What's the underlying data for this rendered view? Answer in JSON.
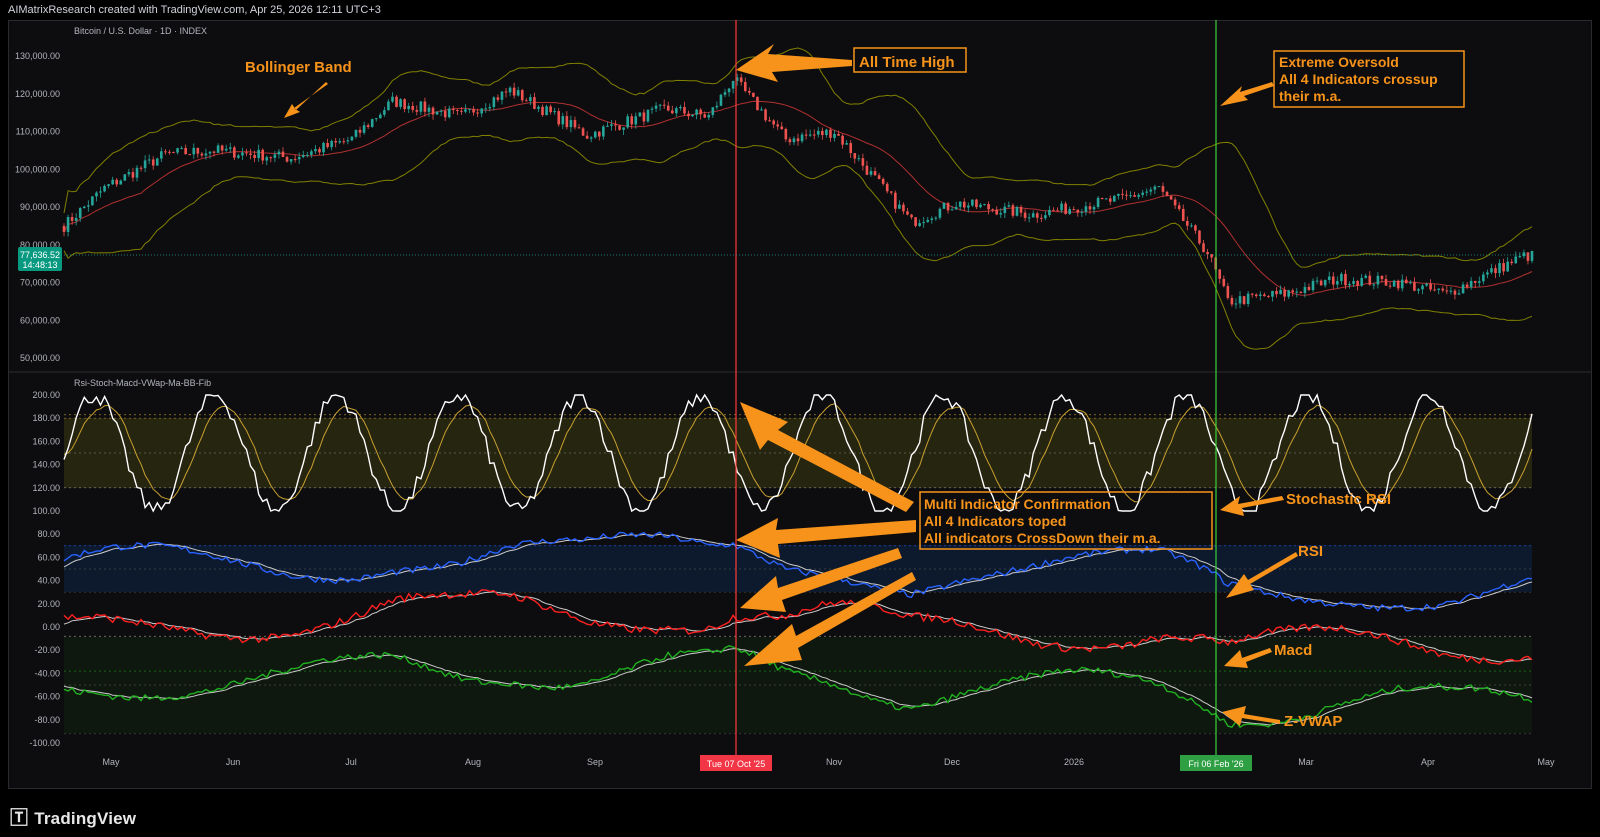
{
  "header": {
    "attribution": "AIMatrixResearch created with TradingView.com, Apr 25, 2026 12:11 UTC+3",
    "symbol_title": "Bitcoin / U.S. Dollar · 1D · INDEX",
    "indicator_title": "Rsi-Stoch-Macd-VWap-Ma-BB-Fib"
  },
  "footer": {
    "brand": "TradingView"
  },
  "price_badge": {
    "price": "77,636.52",
    "countdown": "14:48:13"
  },
  "markers": {
    "top_date": "Tue 07 Oct '25",
    "bottom_date": "Fri 06 Feb '26"
  },
  "annotations": {
    "bollinger": "Bollinger Band",
    "ath": "All Time High",
    "oversold": [
      "Extreme Oversold",
      "All 4 Indicators crossup",
      "their m.a."
    ],
    "confirmation": [
      "Multi Indicator Confirmation",
      "All 4 Indicators toped",
      "All indicators  CrossDown their m.a."
    ],
    "stoch": "Stochastic RSI",
    "rsi": "RSI",
    "macd": "Macd",
    "zvwap": "Z-VWAP"
  },
  "colors": {
    "candle_up": "#26a69a",
    "candle_down": "#ef5350",
    "bb_band": "#808000",
    "bb_mid": "#b03030",
    "stoch": "#ffffff",
    "stoch_signal": "#c8a030",
    "rsi": "#2962ff",
    "macd": "#ff2020",
    "zvwap": "#20b020",
    "annotation": "#f7931a",
    "top_line": "#ff3b3b",
    "bottom_line": "#3bd03b"
  },
  "chart_data": [
    {
      "type": "candlestick",
      "title": "Bitcoin / U.S. Dollar · 1D · INDEX",
      "ylim": [
        50000,
        130000
      ],
      "y_ticks": [
        "130,000.00",
        "120,000.00",
        "110,000.00",
        "100,000.00",
        "90,000.00",
        "80,000.00",
        "70,000.00",
        "60,000.00",
        "50,000.00"
      ],
      "x_ticks": [
        "May",
        "Jun",
        "Jul",
        "Aug",
        "Sep",
        "Nov",
        "Dec",
        "2026",
        "Mar",
        "Apr",
        "May"
      ],
      "last_price": 77636.52,
      "approx_close_path": [
        {
          "x": "2025-04-25",
          "y": 85000
        },
        {
          "x": "2025-05-05",
          "y": 95000
        },
        {
          "x": "2025-05-20",
          "y": 104000
        },
        {
          "x": "2025-06-01",
          "y": 105000
        },
        {
          "x": "2025-06-20",
          "y": 103000
        },
        {
          "x": "2025-07-05",
          "y": 108000
        },
        {
          "x": "2025-07-15",
          "y": 118000
        },
        {
          "x": "2025-08-01",
          "y": 114000
        },
        {
          "x": "2025-08-13",
          "y": 121000
        },
        {
          "x": "2025-09-01",
          "y": 109000
        },
        {
          "x": "2025-09-20",
          "y": 116000
        },
        {
          "x": "2025-10-01",
          "y": 114000
        },
        {
          "x": "2025-10-07",
          "y": 124000
        },
        {
          "x": "2025-10-20",
          "y": 108000
        },
        {
          "x": "2025-11-01",
          "y": 110000
        },
        {
          "x": "2025-11-20",
          "y": 86000
        },
        {
          "x": "2025-12-01",
          "y": 91000
        },
        {
          "x": "2025-12-20",
          "y": 88000
        },
        {
          "x": "2026-01-10",
          "y": 92000
        },
        {
          "x": "2026-01-20",
          "y": 95000
        },
        {
          "x": "2026-02-01",
          "y": 78000
        },
        {
          "x": "2026-02-06",
          "y": 65000
        },
        {
          "x": "2026-02-20",
          "y": 67000
        },
        {
          "x": "2026-03-05",
          "y": 71000
        },
        {
          "x": "2026-03-20",
          "y": 70000
        },
        {
          "x": "2026-04-01",
          "y": 67000
        },
        {
          "x": "2026-04-20",
          "y": 77000
        }
      ]
    },
    {
      "type": "line",
      "title": "Rsi-Stoch-Macd-VWap-Ma-BB-Fib",
      "ylim": [
        -100,
        200
      ],
      "y_ticks": [
        "200.00",
        "180.00",
        "160.00",
        "140.00",
        "120.00",
        "100.00",
        "80.00",
        "60.00",
        "40.00",
        "20.00",
        "0.00",
        "-20.00",
        "-40.00",
        "-60.00",
        "-80.00",
        "-100.00"
      ],
      "series": [
        {
          "name": "Stochastic RSI"
        },
        {
          "name": "RSI"
        },
        {
          "name": "Macd"
        },
        {
          "name": "Z-VWAP"
        }
      ]
    }
  ]
}
